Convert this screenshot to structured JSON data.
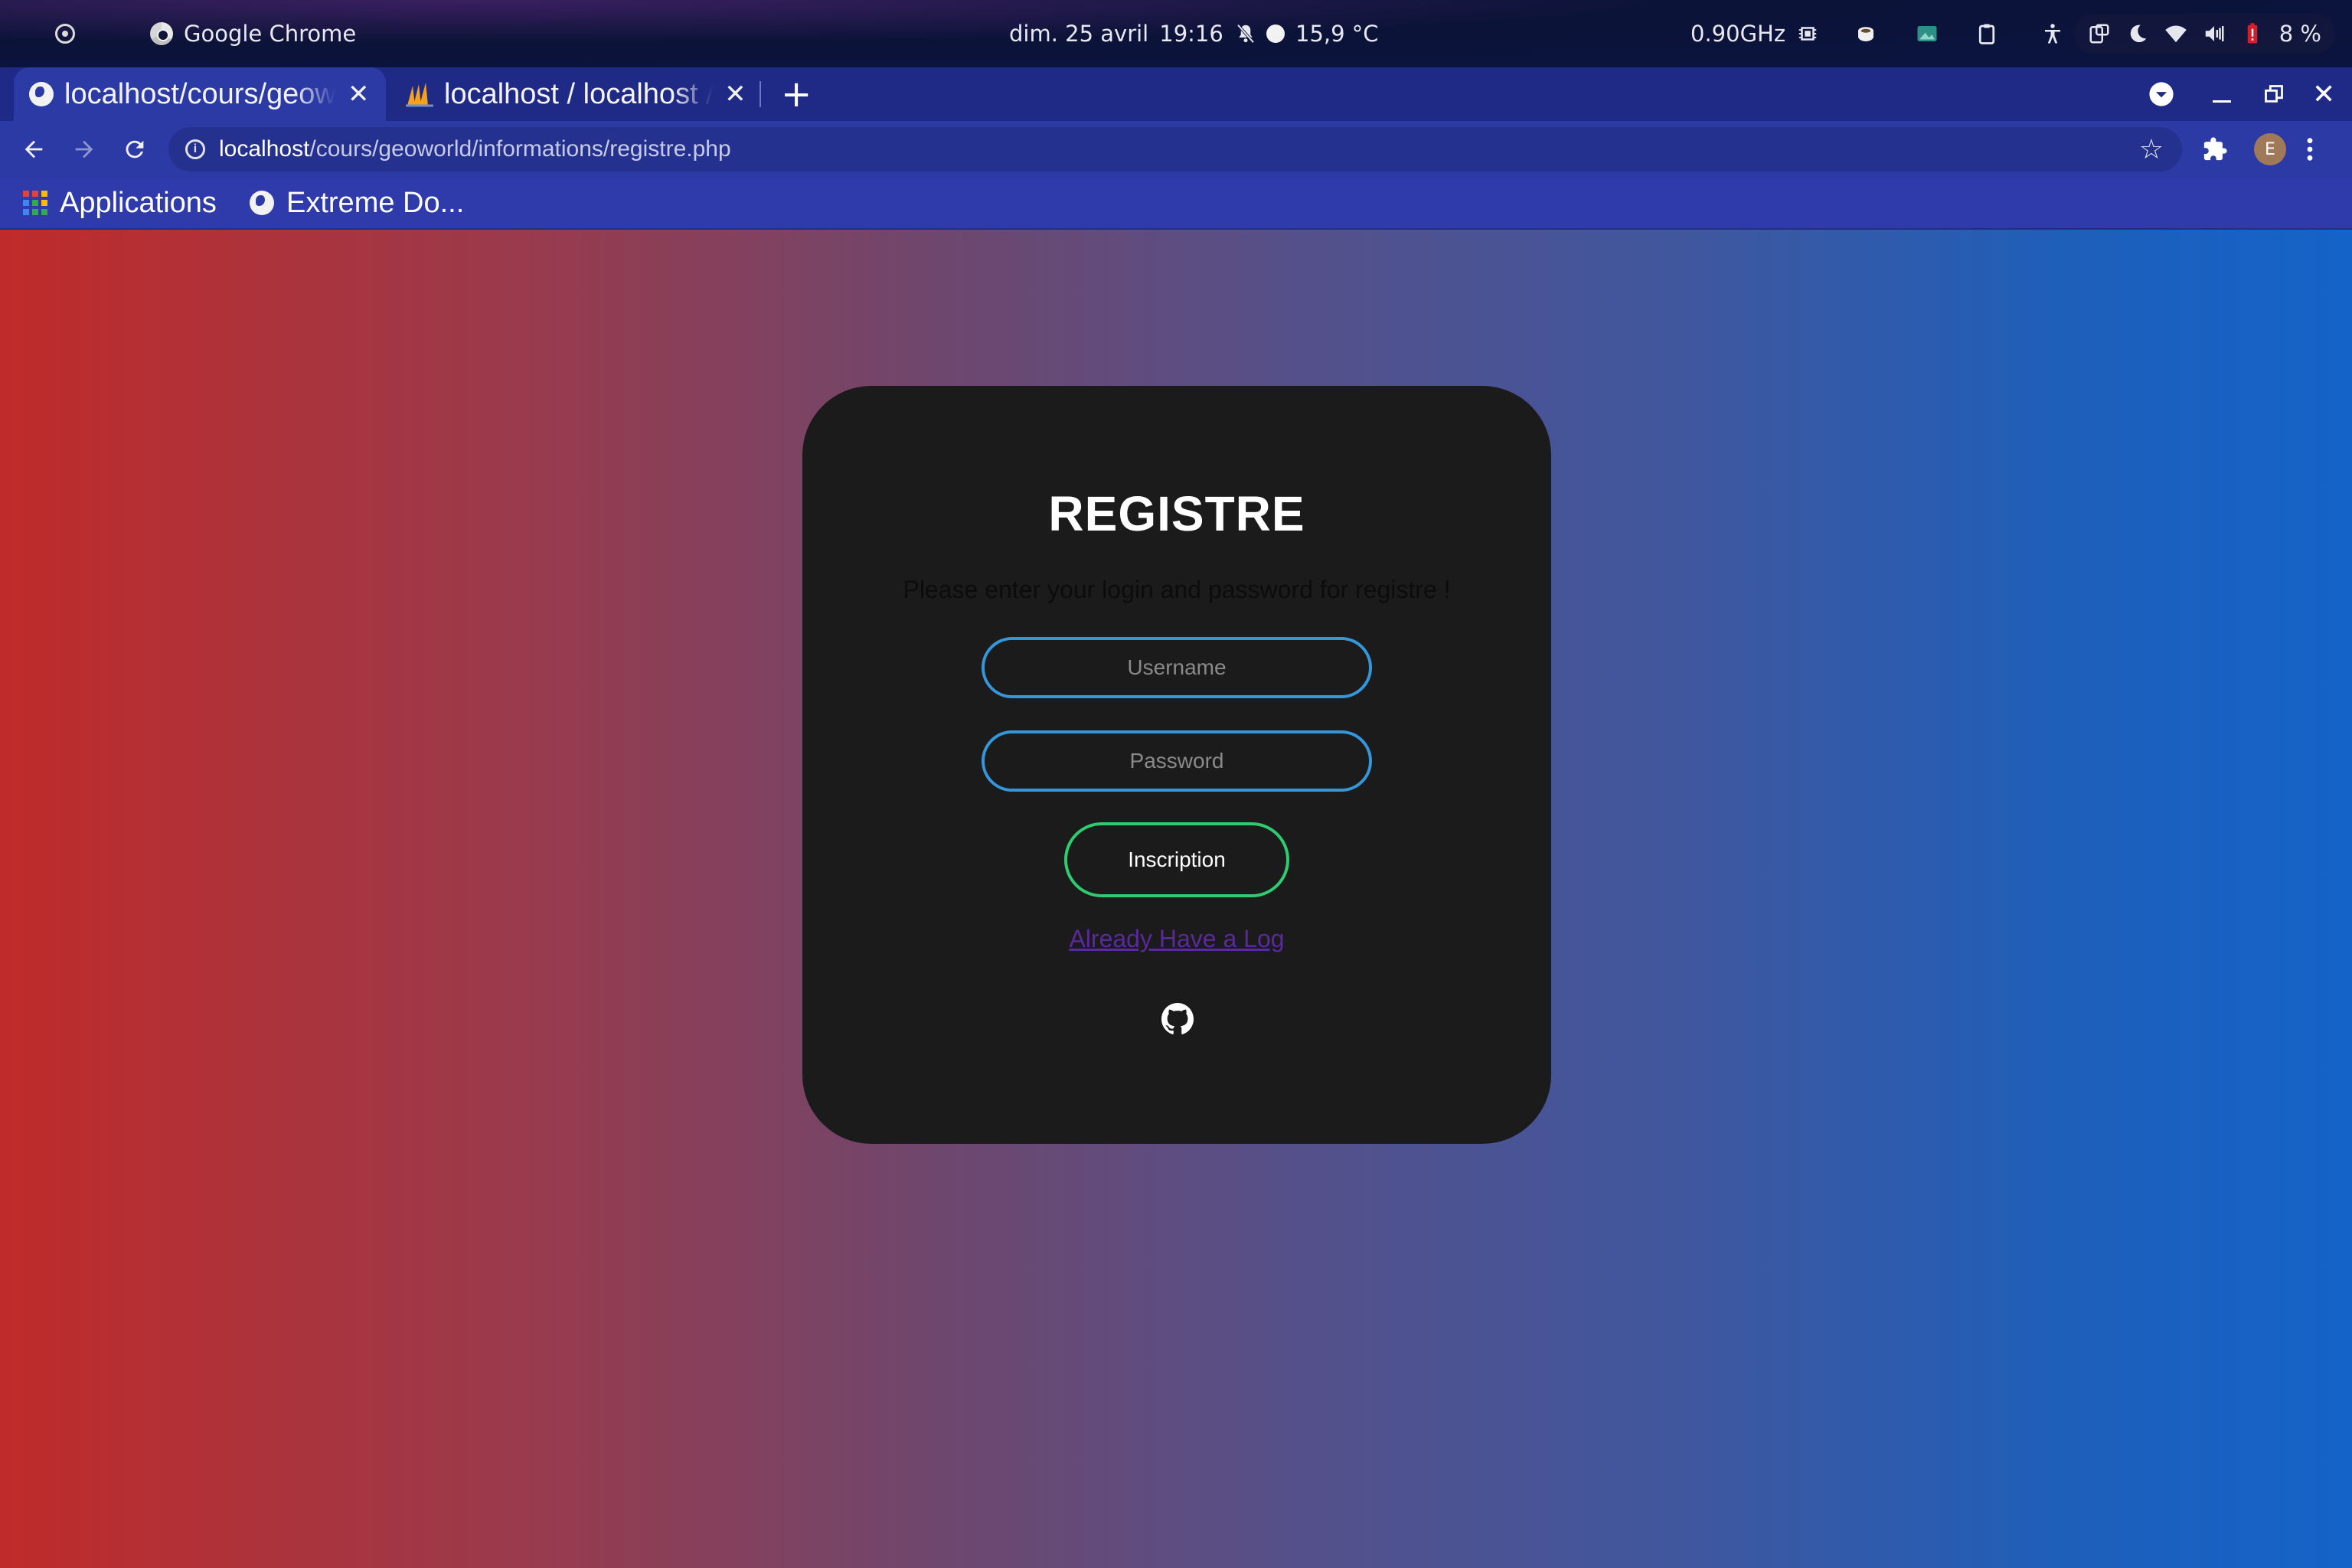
{
  "system_bar": {
    "app_name": "Google Chrome",
    "date": "dim. 25 avril",
    "time": "19:16",
    "weather": "15,9 °C",
    "cpu_freq": "0.90GHz",
    "battery": "8 %"
  },
  "tabs": [
    {
      "title": "localhost/cours/geoworld/informations/registre.php",
      "active": true,
      "icon": "globe-icon"
    },
    {
      "title": "localhost / localhost / geoworld",
      "active": false,
      "icon": "phpmyadmin-icon"
    }
  ],
  "omnibox": {
    "host": "localhost",
    "path": "/cours/geoworld/informations/registre.php"
  },
  "profile": {
    "initial": "E"
  },
  "bookmarks": [
    {
      "label": "Applications",
      "icon": "apps-grid-icon"
    },
    {
      "label": "Extreme Do...",
      "icon": "globe-icon"
    }
  ],
  "form": {
    "title": "REGISTRE",
    "subtitle": "Please enter your login and password for registre !",
    "username_placeholder": "Username",
    "password_placeholder": "Password",
    "submit_label": "Inscription",
    "login_link": "Already Have a Log"
  },
  "colors": {
    "input_border": "#3497db",
    "button_border": "#2ecc71",
    "card_bg": "#1b1b1b",
    "gradient_left": "#bf2b2a",
    "gradient_right": "#1463c8"
  }
}
